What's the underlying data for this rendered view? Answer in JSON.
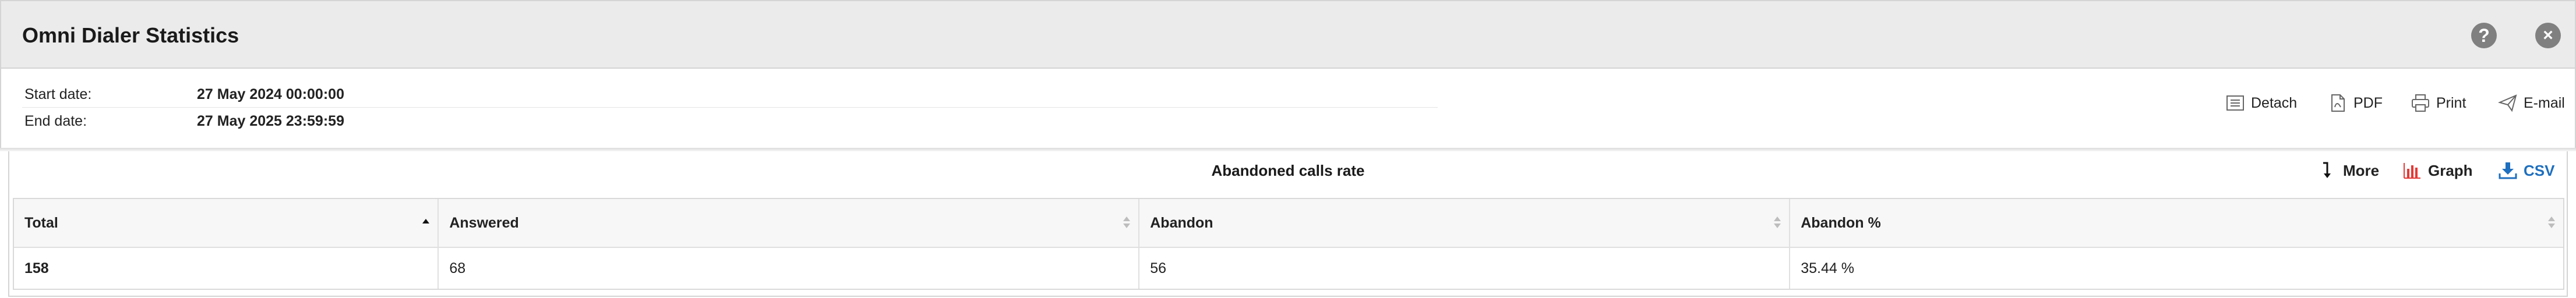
{
  "window": {
    "title": "Omni Dialer Statistics",
    "help_icon": "?",
    "close_icon": "×"
  },
  "dates": {
    "start_label": "Start date:",
    "start_value": "27 May 2024 00:00:00",
    "end_label": "End date:",
    "end_value": "27 May 2025 23:59:59"
  },
  "actions": {
    "detach": "Detach",
    "pdf": "PDF",
    "print": "Print",
    "email": "E-mail"
  },
  "report": {
    "title": "Abandoned calls rate",
    "more": "More",
    "graph": "Graph",
    "csv": "CSV",
    "columns": [
      "Total",
      "Answered",
      "Abandon",
      "Abandon %"
    ],
    "rows": [
      [
        "158",
        "68",
        "56",
        "35.44 %"
      ]
    ]
  },
  "colors": {
    "graph_icon": "#e53935",
    "csv_accent": "#1e6fbf",
    "titlebar": "#ebebeb"
  }
}
